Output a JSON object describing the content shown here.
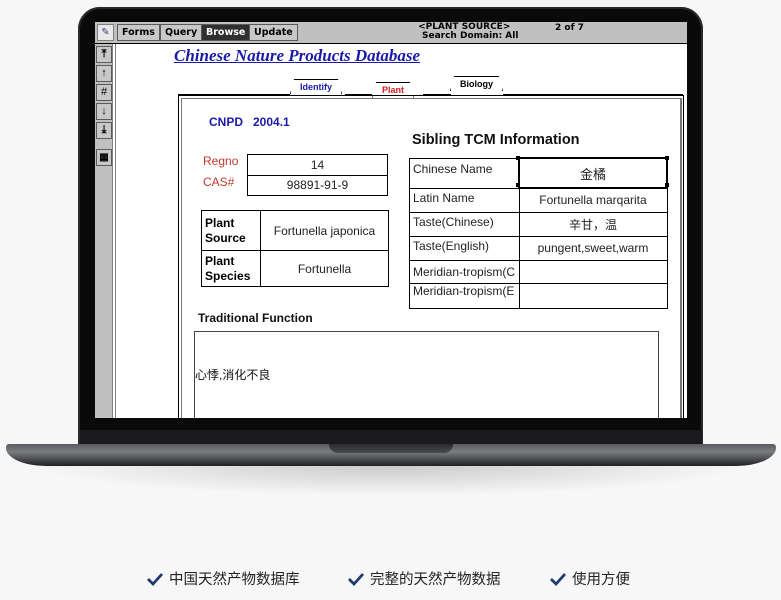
{
  "toolbar": {
    "app_icon": "app-logo-icon",
    "modes": [
      {
        "label": "Forms",
        "active": false
      },
      {
        "label": "Query",
        "active": false
      },
      {
        "label": "Browse",
        "active": true
      },
      {
        "label": "Update",
        "active": false
      }
    ],
    "record_title": "<PLANT SOURCE>",
    "search_domain": "Search Domain: All",
    "record_position": "2  of 7"
  },
  "nav": {
    "buttons": [
      {
        "icon": "first-record-icon",
        "glyph": "⤒"
      },
      {
        "icon": "previous-record-icon",
        "glyph": "🡅"
      },
      {
        "icon": "goto-record-icon",
        "glyph": "#"
      },
      {
        "icon": "next-record-icon",
        "glyph": "🡇"
      },
      {
        "icon": "last-record-icon",
        "glyph": "⤓"
      },
      {
        "icon": "table-view-icon",
        "glyph": "▦"
      }
    ]
  },
  "page": {
    "db_title": "Chinese Nature Products Database",
    "tabs": [
      {
        "label": "Identify",
        "color": "#1a1aa8"
      },
      {
        "label": "Plant",
        "color": "#d42020",
        "active": true
      },
      {
        "label": "Biology",
        "color": "#000000"
      }
    ],
    "version": "CNPD   2004.1",
    "regno_label": "Regno",
    "regno_value": "14",
    "cas_label": "CAS#",
    "cas_value": "98891-91-9",
    "plant_table": [
      {
        "label": "Plant\nSource",
        "value": "Fortunella japonica"
      },
      {
        "label": "Plant\nSpecies",
        "value": "Fortunella"
      }
    ],
    "sibling_title": "Sibling TCM Information",
    "sibling_rows": [
      {
        "label": "Chinese Name",
        "value": "金橘"
      },
      {
        "label": "Latin Name",
        "value": "Fortunella marqarita"
      },
      {
        "label": "Taste(Chinese)",
        "value": "辛甘，温"
      },
      {
        "label": "Taste(English)",
        "value": "pungent,sweet,warm"
      },
      {
        "label": "Meridian-tropism(C",
        "value": ""
      },
      {
        "label": "Meridian-tropism(E",
        "value": ""
      }
    ],
    "traditional_function_title": "Traditional Function",
    "traditional_function_text": "心悸,消化不良"
  },
  "features": [
    {
      "icon": "check-icon",
      "label": "中国天然产物数据库"
    },
    {
      "icon": "check-icon",
      "label": "完整的天然产物数据"
    },
    {
      "icon": "check-icon",
      "label": "使用方便"
    }
  ],
  "colors": {
    "accent_blue": "#1a1aa8",
    "label_red": "#c0392b",
    "check_navy": "#1f3a6e"
  }
}
